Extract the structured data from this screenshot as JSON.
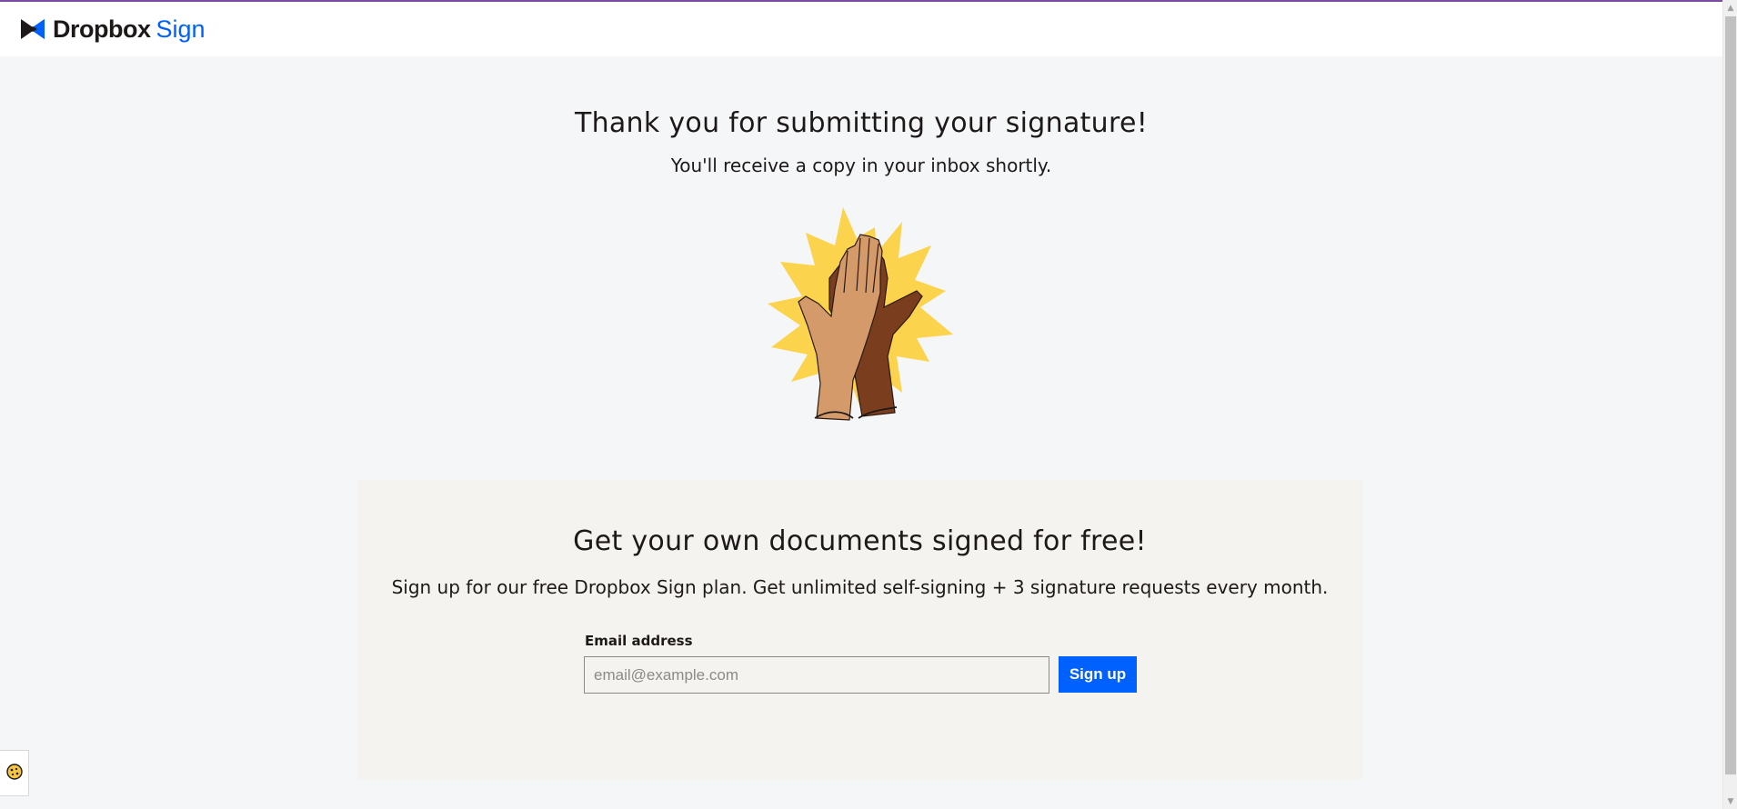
{
  "header": {
    "brand": "Dropbox",
    "product": "Sign"
  },
  "thanks": {
    "title": "Thank you for submitting your signature!",
    "subtitle": "You'll receive a copy in your inbox shortly."
  },
  "promo": {
    "title": "Get your own documents signed for free!",
    "text": "Sign up for our free Dropbox Sign plan. Get unlimited self-signing + 3 signature requests every month.",
    "email_label": "Email address",
    "email_placeholder": "email@example.com",
    "email_value": "",
    "signup_label": "Sign up"
  },
  "colors": {
    "brand_blue": "#0061fe",
    "burst_yellow": "#fcd34d",
    "top_accent": "#7b4ba3"
  },
  "icons": {
    "logo": "dropbox-logo-icon",
    "cookie": "cookie-icon",
    "illustration": "high-five-illustration"
  }
}
